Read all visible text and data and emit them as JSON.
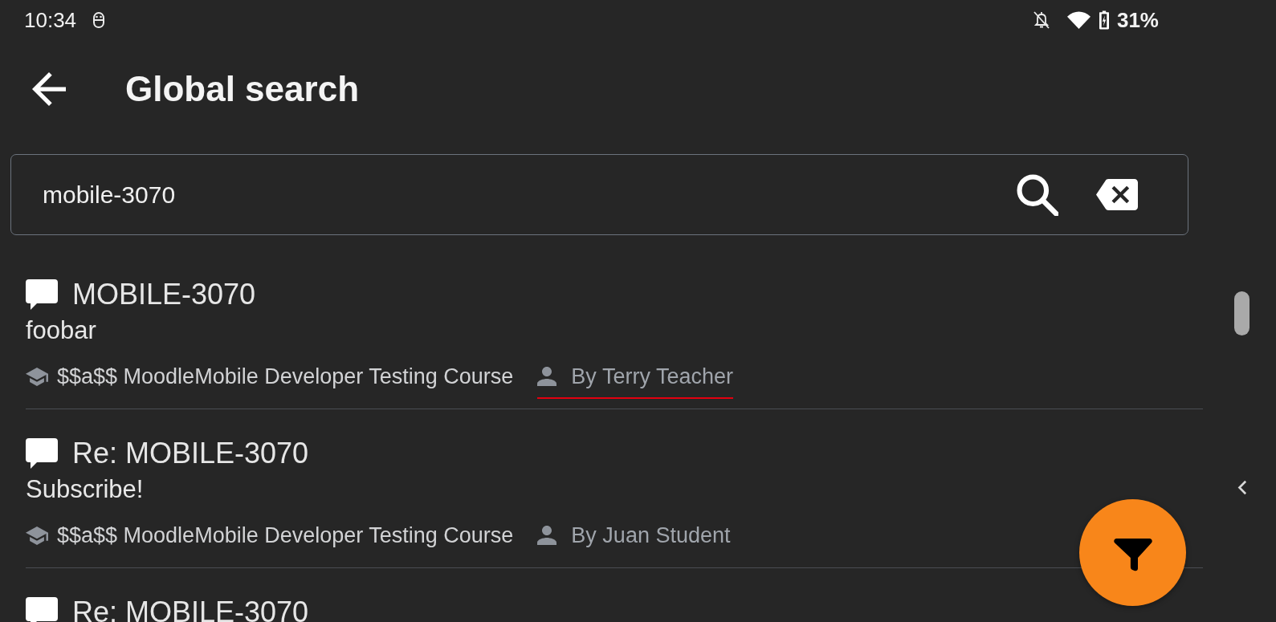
{
  "status_bar": {
    "time": "10:34",
    "battery": "31%"
  },
  "header": {
    "title": "Global search"
  },
  "search": {
    "value": "mobile-3070"
  },
  "results": [
    {
      "title": "MOBILE-3070",
      "body": "foobar",
      "course": "$$a$$ MoodleMobile Developer Testing Course",
      "author": "By Terry Teacher",
      "underlined": true
    },
    {
      "title": "Re: MOBILE-3070",
      "body": "Subscribe!",
      "course": "$$a$$ MoodleMobile Developer Testing Course",
      "author": "By Juan Student",
      "underlined": false
    },
    {
      "title": "Re: MOBILE-3070"
    }
  ]
}
